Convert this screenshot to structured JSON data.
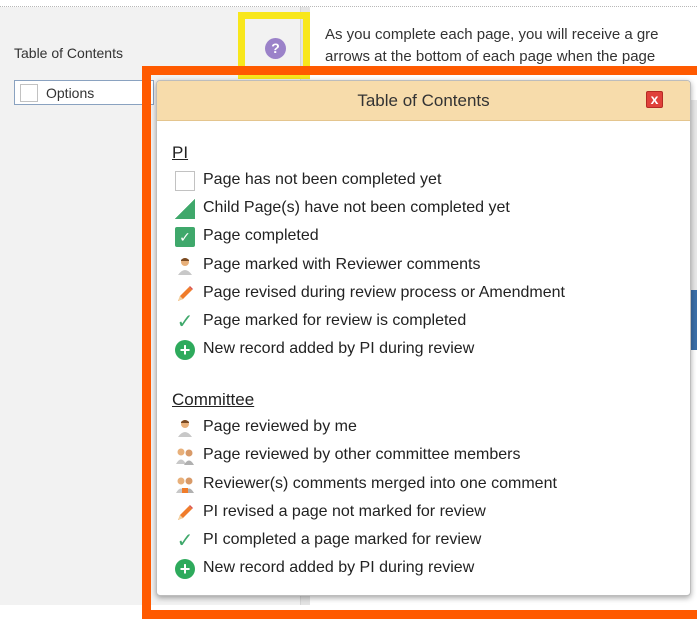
{
  "sidebar": {
    "title": "Table of Contents",
    "options_label": "Options"
  },
  "intro": {
    "line1": "As you complete each page, you will receive a gre",
    "line2": "arrows at the bottom of each page when the page"
  },
  "help_icon_glyph": "?",
  "popup": {
    "title": "Table of Contents",
    "close_glyph": "x",
    "pi_section": {
      "title": "PI",
      "items": [
        {
          "icon": "empty-box-icon",
          "label": "Page has not been completed yet"
        },
        {
          "icon": "partial-triangle-icon",
          "label": "Child Page(s) have not been completed yet"
        },
        {
          "icon": "checked-box-icon",
          "label": "Page completed"
        },
        {
          "icon": "reviewer-icon",
          "label": "Page marked with Reviewer comments"
        },
        {
          "icon": "pencil-icon",
          "label": "Page revised during review process or Amendment"
        },
        {
          "icon": "checkmark-icon",
          "label": "Page marked for review is completed"
        },
        {
          "icon": "plus-circle-icon",
          "label": "New record added by PI during review"
        }
      ]
    },
    "committee_section": {
      "title": "Committee",
      "items": [
        {
          "icon": "reviewer-icon",
          "label": "Page reviewed by me"
        },
        {
          "icon": "two-reviewers-icon",
          "label": "Page reviewed by other committee members"
        },
        {
          "icon": "merged-reviewers-icon",
          "label": "Reviewer(s) comments merged into one comment"
        },
        {
          "icon": "pencil-icon",
          "label": "PI revised a page not marked for review"
        },
        {
          "icon": "checkmark-icon",
          "label": "PI completed a page marked for review"
        },
        {
          "icon": "plus-circle-icon",
          "label": "New record added by PI during review"
        }
      ]
    }
  },
  "colors": {
    "highlight_yellow": "#f8e71c",
    "highlight_orange": "#ff5a00",
    "popup_header": "#f7dcab",
    "complete_green": "#3fa86b",
    "close_red": "#e0413a",
    "help_purple": "#9b82c9"
  }
}
